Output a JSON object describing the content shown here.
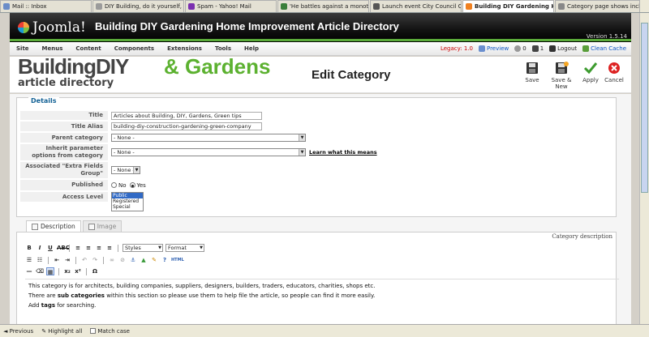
{
  "browser_tabs": [
    {
      "title": "Mail :: Inbox",
      "color": "#6a8cc8"
    },
    {
      "title": "DIY Building, do it yourself, gr...",
      "color": "#9b9b9b"
    },
    {
      "title": "Spam - Yahoo! Mail",
      "color": "#7b2fb0"
    },
    {
      "title": "'He battles against a monoton...",
      "color": "#3a7f3a"
    },
    {
      "title": "Launch event City Council Cha...",
      "color": "#555555"
    },
    {
      "title": "Building DIY Gardening H...",
      "color": "#f08020",
      "active": true
    },
    {
      "title": "Category page shows include...",
      "color": "#888888"
    }
  ],
  "header": {
    "logo": "Joomla!",
    "title": "Building DIY Gardening Home Improvement Article Directory",
    "version": "Version 1.5.14"
  },
  "menu": {
    "items": [
      "Site",
      "Menus",
      "Content",
      "Components",
      "Extensions",
      "Tools",
      "Help"
    ],
    "legacy": "Legacy: 1.0",
    "preview": "Preview",
    "messages": "0",
    "users": "1",
    "logout": "Logout",
    "clean_cache": "Clean Cache"
  },
  "toolbar": {
    "brand_line1a": "BuildingDIY",
    "brand_line1b": "& Gardens",
    "brand_line2": "article directory",
    "page_title": "Edit Category",
    "save": "Save",
    "save_new": "Save & New",
    "apply": "Apply",
    "cancel": "Cancel"
  },
  "details": {
    "legend": "Details",
    "title_label": "Title",
    "title_value": "Articles about Building, DIY, Gardens, Green tips",
    "alias_label": "Title Alias",
    "alias_value": "building-diy-construction-gardening-green-company",
    "parent_label": "Parent category",
    "parent_value": "- None -",
    "inherit_label": "Inherit parameter options from category",
    "inherit_value": "- None -",
    "learn_more": "Learn what this means",
    "extra_label": "Associated \"Extra Fields Group\"",
    "extra_value": "- None -",
    "published_label": "Published",
    "published_no": "No",
    "published_yes": "Yes",
    "access_label": "Access Level",
    "access_options": [
      "Public",
      "Registered",
      "Special"
    ]
  },
  "editor": {
    "tab_description": "Description",
    "tab_image": "Image",
    "category_description": "Category description",
    "styles": "Styles",
    "format": "Format",
    "line1": "This category is for architects, building companies, suppliers, designers, builders, traders, educators, charities, shops etc.",
    "line2a": "There are ",
    "line2b": "sub categories",
    "line2c": " within this section so please use them to help file the article, so people can find it more easily.",
    "line3a": "Add ",
    "line3b": "tags",
    "line3c": " for searching."
  },
  "findbar": {
    "previous": "Previous",
    "highlight": "Highlight all",
    "match_case": "Match case"
  }
}
